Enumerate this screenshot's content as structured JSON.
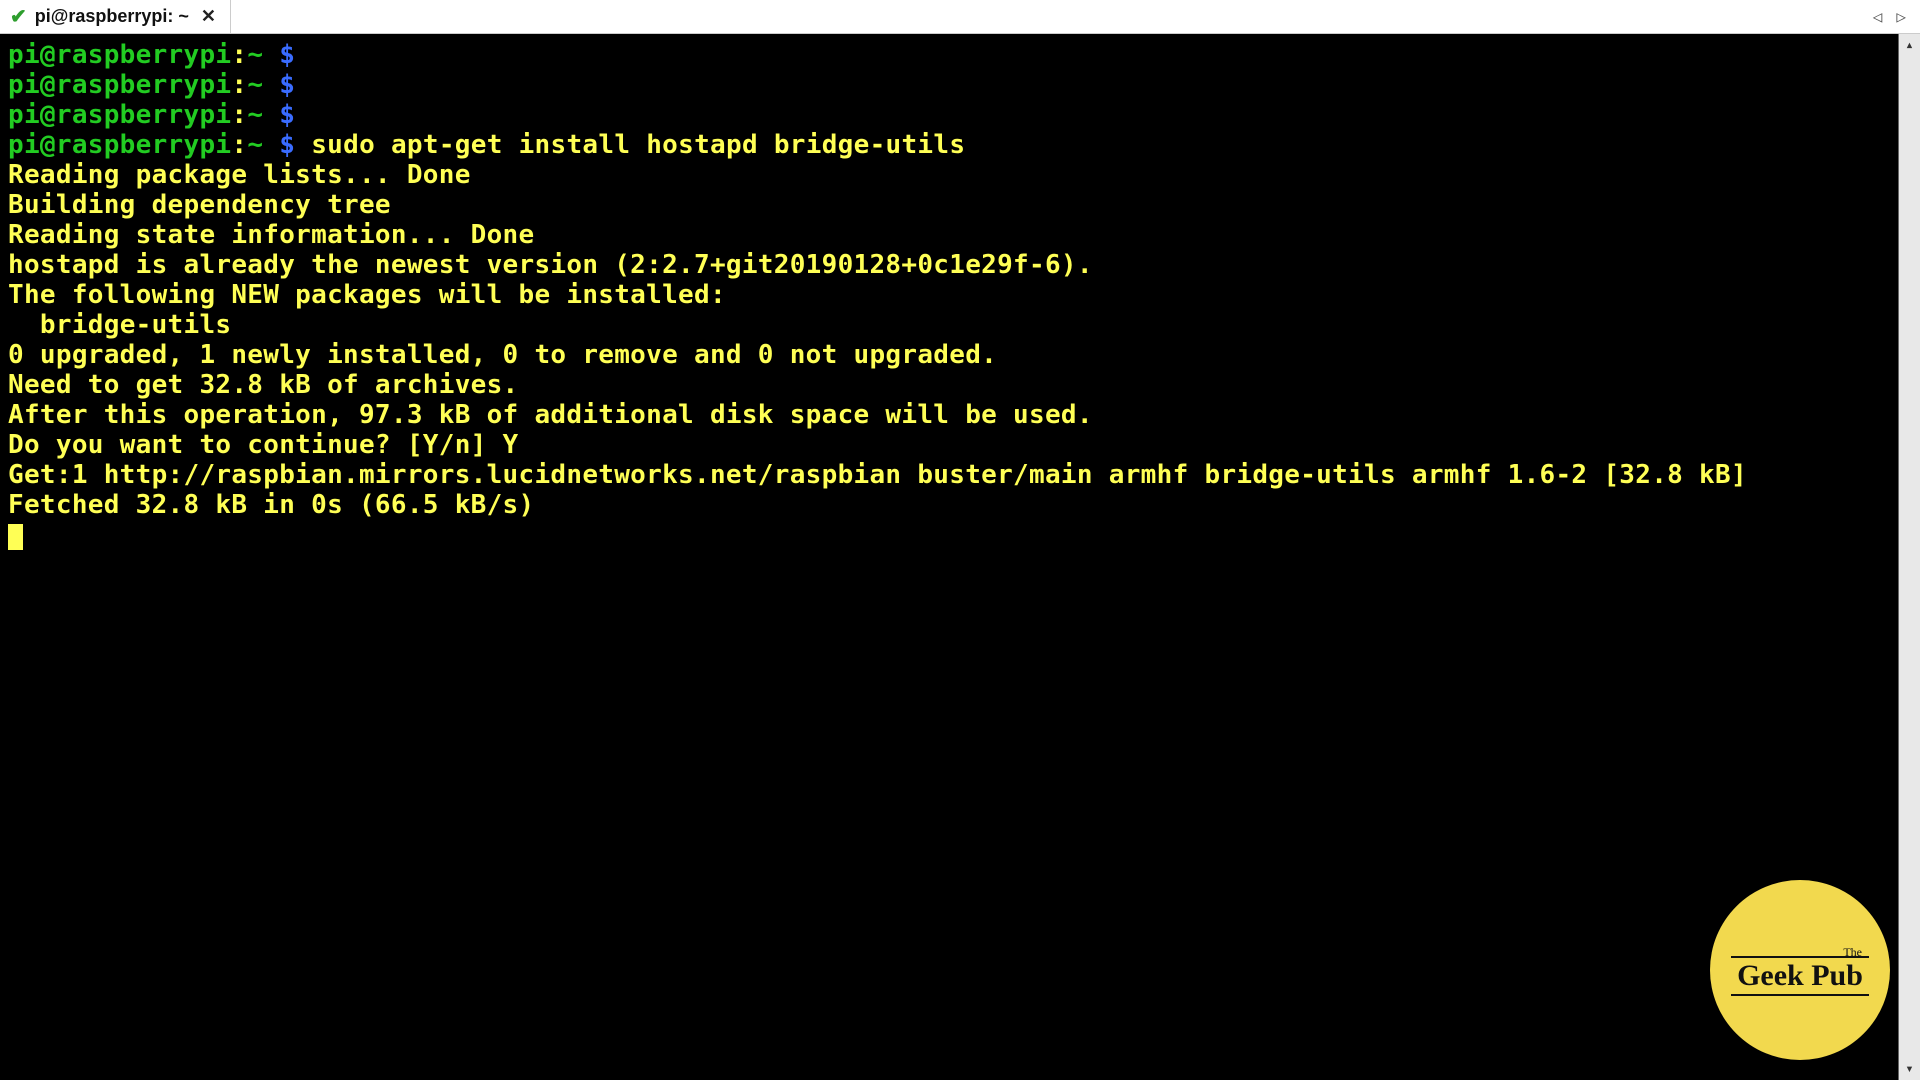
{
  "tab": {
    "title": "pi@raspberrypi: ~"
  },
  "prompt": {
    "user_host": "pi@raspberrypi",
    "sep": ":",
    "path": "~",
    "symbol": "$"
  },
  "cmd": {
    "install": "sudo apt-get install hostapd bridge-utils"
  },
  "out": {
    "l1": "Reading package lists... Done",
    "l2": "Building dependency tree",
    "l3": "Reading state information... Done",
    "l4": "hostapd is already the newest version (2:2.7+git20190128+0c1e29f-6).",
    "l5": "The following NEW packages will be installed:",
    "l6": "  bridge-utils",
    "l7": "0 upgraded, 1 newly installed, 0 to remove and 0 not upgraded.",
    "l8": "Need to get 32.8 kB of archives.",
    "l9": "After this operation, 97.3 kB of additional disk space will be used.",
    "l10": "Do you want to continue? [Y/n] Y",
    "l11": "Get:1 http://raspbian.mirrors.lucidnetworks.net/raspbian buster/main armhf bridge-utils armhf 1.6-2 [32.8 kB]",
    "l12": "Fetched 32.8 kB in 0s (66.5 kB/s)"
  },
  "logo": {
    "the": "The",
    "main": "Geek Pub"
  }
}
